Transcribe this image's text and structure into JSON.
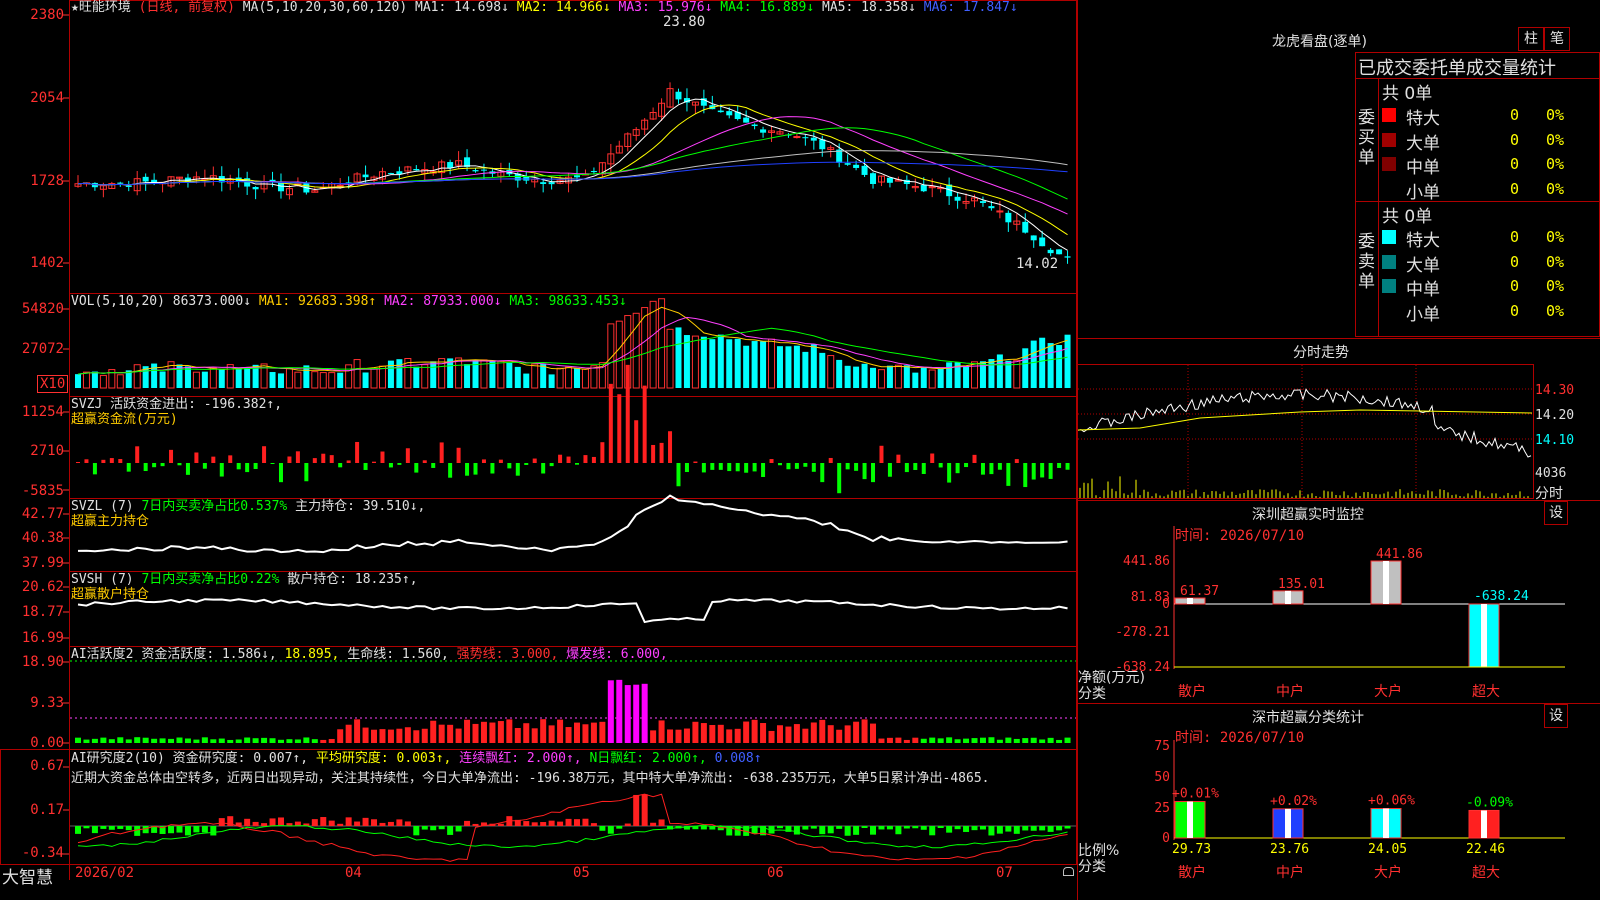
{
  "header": {
    "stock": "★旺能环境",
    "mode": "(日线, 前复权)",
    "ma_label": "MA(5,10,20,30,60,120)",
    "ma1": "MA1: 14.698↓",
    "ma2": "MA2: 14.966↓",
    "ma3": "MA3: 15.976↓",
    "ma4": "MA4: 16.889↓",
    "ma5": "MA5: 18.358↓",
    "ma6": "MA6: 17.847↓",
    "high_mark": "23.80",
    "low_mark": "14.02"
  },
  "main_axis": [
    "2380",
    "2054",
    "1728",
    "1402"
  ],
  "vol": {
    "label": "VOL(5,10,20)",
    "value": "86373.000↓",
    "ma1": "MA1: 92683.398↑",
    "ma2": "MA2: 87933.000↓",
    "ma3": "MA3: 98633.453↓",
    "axis": [
      "54820",
      "27072"
    ],
    "unit": "X10"
  },
  "svzj": {
    "label": "SVZJ  活跃资金进出: -196.382↑,",
    "sub": "超赢资金流(万元)",
    "axis": [
      "11254",
      "2710",
      "-5835"
    ]
  },
  "svzl": {
    "label": "SVZL (7)",
    "pct": "7日内买卖净占比0.537%",
    "hold": "主力持仓: 39.510↓,",
    "sub": "超赢主力持仓",
    "axis": [
      "42.77",
      "40.38",
      "37.99"
    ]
  },
  "svsh": {
    "label": "SVSH (7)",
    "pct": "7日内买卖净占比0.22%",
    "hold": "散户持仓: 18.235↑,",
    "sub": "超赢散户持仓",
    "axis": [
      "20.62",
      "18.77",
      "16.99"
    ]
  },
  "ai1": {
    "label": "AI活跃度2",
    "a": "资金活跃度: 1.586↓,",
    "b": "18.895,",
    "c": "生命线: 1.560,",
    "d": "强势线: 3.000,",
    "e": "爆发线: 6.000,",
    "axis": [
      "18.90",
      "9.33",
      "0.00"
    ]
  },
  "ai2": {
    "label": "AI研究度2(10)",
    "a": "资金研究度: 0.007↑,",
    "b": "平均研究度: 0.003↑,",
    "c": "连续飘红: 2.000↑,",
    "d": "N日飘红: 2.000↑,",
    "e": "0.008↑",
    "text": "近期大资金总体由空转多，近两日出现异动，关注其持续性，今日大单净流出: -196.38万元，其中特大单净流出: -638.235万元，大单5日累计净出-4865.",
    "axis": [
      "0.67",
      "0.17",
      "-0.34"
    ]
  },
  "dates": [
    "2026/02",
    "04",
    "05",
    "06",
    "07"
  ],
  "logo": "大智慧",
  "right": {
    "dragon_title": "龙虎看盘(逐单)",
    "btn_bar": "柱",
    "btn_pen": "笔",
    "tabs": "已成交委托单成交量统计",
    "buy_group": "委买单",
    "sell_group": "委卖单",
    "buy_total": "共 0单",
    "sell_total": "共 0单",
    "buy_rows": [
      {
        "name": "特大",
        "count": "0",
        "pct": "0%",
        "color": "#ff0000"
      },
      {
        "name": "大单",
        "count": "0",
        "pct": "0%",
        "color": "#a00000"
      },
      {
        "name": "中单",
        "count": "0",
        "pct": "0%",
        "color": "#800000"
      },
      {
        "name": "小单",
        "count": "0",
        "pct": "0%",
        "color": ""
      }
    ],
    "sell_rows": [
      {
        "name": "特大",
        "count": "0",
        "pct": "0%",
        "color": "#00ffff"
      },
      {
        "name": "大单",
        "count": "0",
        "pct": "0%",
        "color": "#008080"
      },
      {
        "name": "中单",
        "count": "0",
        "pct": "0%",
        "color": "#008080"
      },
      {
        "name": "小单",
        "count": "0",
        "pct": "0%",
        "color": ""
      }
    ],
    "intraday_title": "分时走势",
    "intraday_axis": [
      "14.30",
      "14.20",
      "14.10"
    ],
    "intraday_vol": "4036",
    "intraday_unit": "分时",
    "monitor_title": "深圳超赢实时监控",
    "monitor_set": "设",
    "monitor_time": "时间: 2026/07/10",
    "monitor_axis": [
      "441.86",
      "81.83",
      "0",
      "-278.21",
      "-638.24"
    ],
    "monitor_ylabel": "净额(万元)",
    "monitor_xlabel": "分类",
    "class_title": "深市超赢分类统计",
    "class_set": "设",
    "class_time": "时间: 2026/07/10",
    "class_axis": [
      "75",
      "50",
      "25",
      "0"
    ],
    "class_ylabel": "比例%",
    "class_xlabel": "分类"
  },
  "chart_data": [
    {
      "type": "bar",
      "title": "深圳超赢实时监控",
      "categories": [
        "散户",
        "中户",
        "大户",
        "超大"
      ],
      "values": [
        61.37,
        135.01,
        441.86,
        -638.24
      ],
      "ylim": [
        -638.24,
        441.86
      ],
      "colors": [
        "#c0c0c0",
        "#c0c0c0",
        "#c0c0c0",
        "#00ffff"
      ]
    },
    {
      "type": "bar",
      "title": "深市超赢分类统计",
      "categories": [
        "散户",
        "中户",
        "大户",
        "超大"
      ],
      "values": [
        29.73,
        23.76,
        24.05,
        22.46
      ],
      "changes": [
        "+0.01%",
        "+0.02%",
        "+0.06%",
        "-0.09%"
      ],
      "ylim": [
        0,
        75
      ],
      "colors": [
        "#00ff00",
        "#2040ff",
        "#00ffff",
        "#ff2020"
      ]
    }
  ]
}
